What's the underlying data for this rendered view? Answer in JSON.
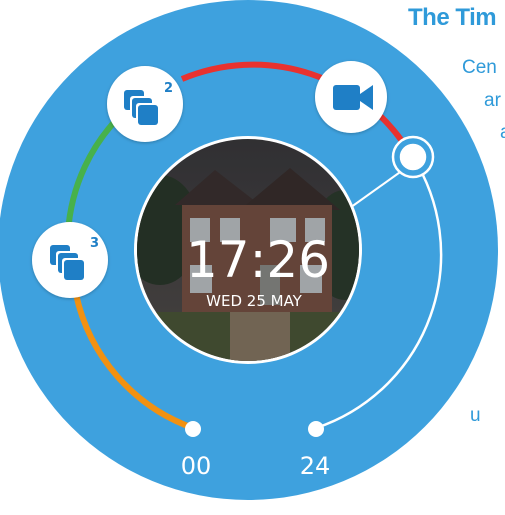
{
  "intro": {
    "heading": "The Tim",
    "line1": "Cen",
    "line2": "ar",
    "line3": "a",
    "line4": "u"
  },
  "clock": {
    "time": "17:26",
    "date": "WED 25 MAY"
  },
  "timeline": {
    "start_label": "00",
    "end_label": "24"
  },
  "events": [
    {
      "icon": "gallery-icon",
      "count": "2"
    },
    {
      "icon": "gallery-icon",
      "count": "3"
    },
    {
      "icon": "video-camera-icon",
      "count": ""
    }
  ],
  "colors": {
    "dial": "#3ea1de",
    "segment_orange": "#f29111",
    "segment_green": "#47b14b",
    "segment_red": "#e8322f",
    "track": "#ffffff"
  }
}
